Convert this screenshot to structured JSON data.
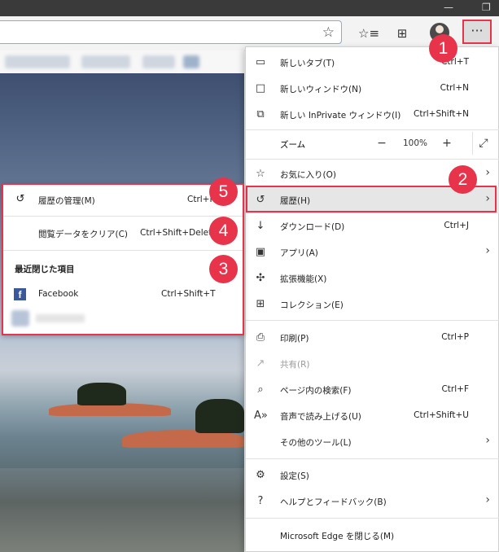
{
  "window_controls": {
    "minimize": "—",
    "restore": "❐"
  },
  "toolbar": {
    "favorite_icon": "☆",
    "favorites_list_icon": "☆≡",
    "collections_icon": "⊞",
    "more_label": "···"
  },
  "menu": {
    "new_tab": {
      "label": "新しいタブ(T)",
      "shortcut": "Ctrl+T"
    },
    "new_window": {
      "label": "新しいウィンドウ(N)",
      "shortcut": "Ctrl+N"
    },
    "new_inprivate": {
      "label": "新しい InPrivate ウィンドウ(I)",
      "shortcut": "Ctrl+Shift+N"
    },
    "zoom": {
      "label": "ズーム",
      "minus": "−",
      "value": "100%",
      "plus": "+",
      "fullscreen": "⤢"
    },
    "favorites": {
      "label": "お気に入り(O)"
    },
    "history": {
      "label": "履歴(H)"
    },
    "downloads": {
      "label": "ダウンロード(D)",
      "shortcut": "Ctrl+J"
    },
    "apps": {
      "label": "アプリ(A)"
    },
    "extensions": {
      "label": "拡張機能(X)"
    },
    "collections": {
      "label": "コレクション(E)"
    },
    "print": {
      "label": "印刷(P)",
      "shortcut": "Ctrl+P"
    },
    "share": {
      "label": "共有(R)"
    },
    "find": {
      "label": "ページ内の検索(F)",
      "shortcut": "Ctrl+F"
    },
    "read_aloud": {
      "label": "音声で読み上げる(U)",
      "shortcut": "Ctrl+Shift+U"
    },
    "more_tools": {
      "label": "その他のツール(L)"
    },
    "settings": {
      "label": "設定(S)"
    },
    "help": {
      "label": "ヘルプとフィードバック(B)"
    },
    "close_edge": {
      "label": "Microsoft Edge を閉じる(M)"
    }
  },
  "history_submenu": {
    "manage": {
      "label": "履歴の管理(M)",
      "shortcut": "Ctrl+H"
    },
    "clear": {
      "label": "閲覧データをクリア(C)",
      "shortcut": "Ctrl+Shift+Delete"
    },
    "recently_closed_heading": "最近閉じた項目",
    "facebook": {
      "label": "Facebook",
      "shortcut": "Ctrl+Shift+T",
      "icon_letter": "f"
    }
  },
  "badges": [
    "1",
    "2",
    "3",
    "4",
    "5"
  ],
  "colors": {
    "highlight": "#e8344b",
    "facebook": "#3b5998"
  }
}
